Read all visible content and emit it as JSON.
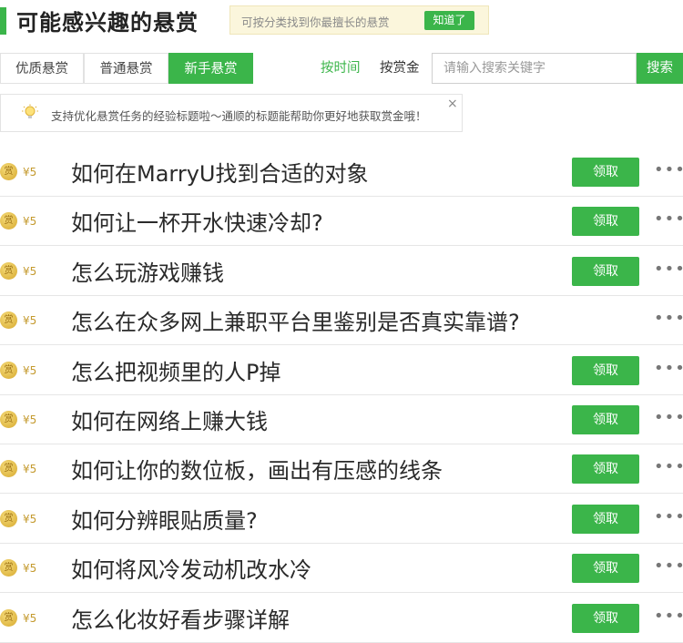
{
  "header": {
    "title": "可能感兴趣的悬赏",
    "hint_text": "可按分类找到你最擅长的悬赏",
    "hint_button": "知道了"
  },
  "tabs": [
    {
      "label": "优质悬赏",
      "active": false
    },
    {
      "label": "普通悬赏",
      "active": false
    },
    {
      "label": "新手悬赏",
      "active": true
    }
  ],
  "sort": {
    "by_time": "按时间",
    "by_reward": "按赏金"
  },
  "search": {
    "placeholder": "请输入搜索关键字",
    "button": "搜索"
  },
  "notice": {
    "text": "支持优化悬赏任务的经验标题啦～通顺的标题能帮助你更好地获取赏金哦！",
    "close": "×"
  },
  "coin_label": "赏",
  "items": [
    {
      "amount": "¥5",
      "title": "如何在MarryU找到合适的对象",
      "button": "领取",
      "more": "•••"
    },
    {
      "amount": "¥5",
      "title": "如何让一杯开水快速冷却?",
      "button": "领取",
      "more": "•••"
    },
    {
      "amount": "¥5",
      "title": "怎么玩游戏赚钱",
      "button": "领取",
      "more": "•••"
    },
    {
      "amount": "¥5",
      "title": "怎么在众多网上兼职平台里鉴别是否真实靠谱?",
      "button": "",
      "more": "•••"
    },
    {
      "amount": "¥5",
      "title": "怎么把视频里的人P掉",
      "button": "领取",
      "more": "•••"
    },
    {
      "amount": "¥5",
      "title": "如何在网络上赚大钱",
      "button": "领取",
      "more": "•••"
    },
    {
      "amount": "¥5",
      "title": "如何让你的数位板，画出有压感的线条",
      "button": "领取",
      "more": "•••"
    },
    {
      "amount": "¥5",
      "title": "如何分辨眼贴质量?",
      "button": "领取",
      "more": "•••"
    },
    {
      "amount": "¥5",
      "title": "如何将风冷发动机改水冷",
      "button": "领取",
      "more": "•••"
    },
    {
      "amount": "¥5",
      "title": "怎么化妆好看步骤详解",
      "button": "领取",
      "more": "•••"
    }
  ],
  "colors": {
    "accent": "#3bb54a",
    "hint_bg": "#fbf6dc"
  }
}
